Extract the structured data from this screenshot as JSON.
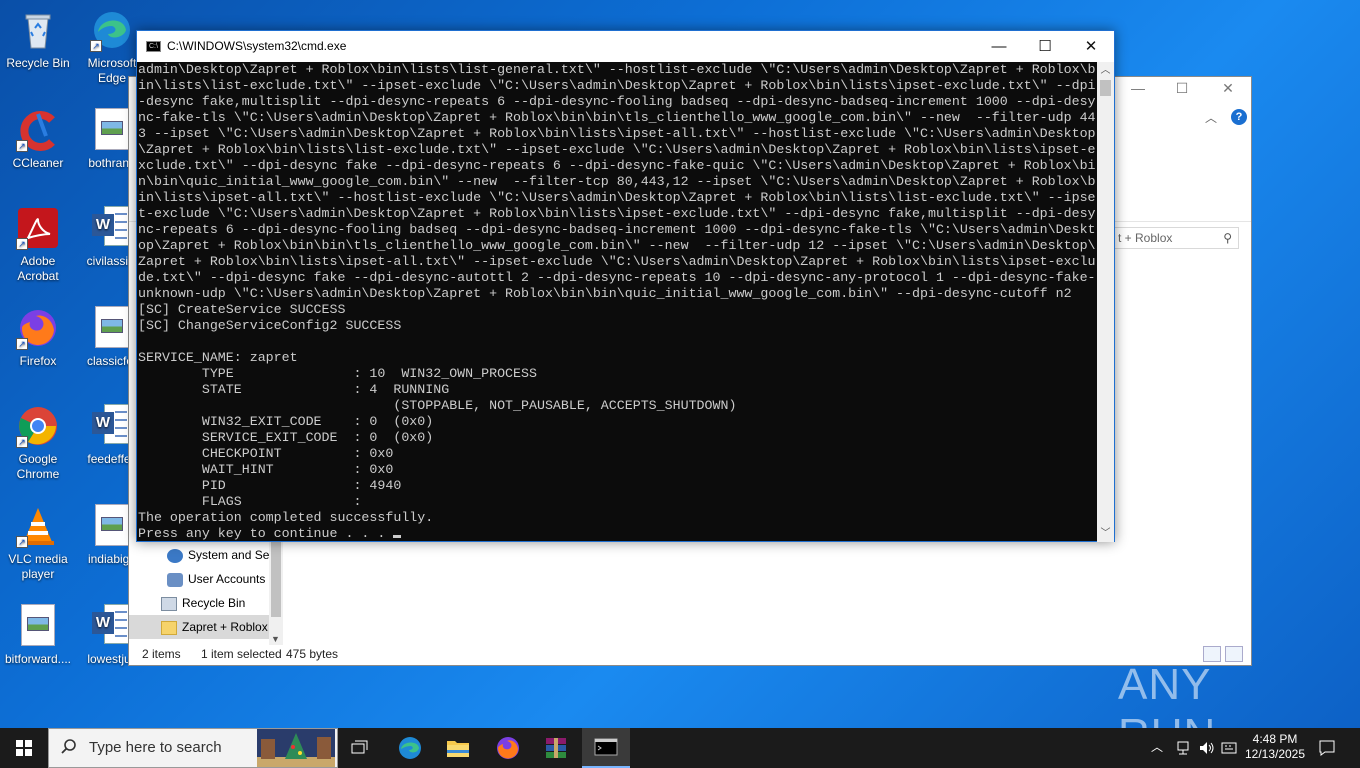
{
  "desktop": {
    "icons": [
      {
        "id": "recycle",
        "label": "Recycle Bin"
      },
      {
        "id": "edge",
        "label": "Microsoft Edge"
      },
      {
        "id": "ccleaner",
        "label": "CCleaner"
      },
      {
        "id": "bothrand",
        "label": "bothrand"
      },
      {
        "id": "acrobat",
        "label": "Adobe Acrobat"
      },
      {
        "id": "civilassist",
        "label": "civilassist"
      },
      {
        "id": "firefox",
        "label": "Firefox"
      },
      {
        "id": "classicfor",
        "label": "classicfor"
      },
      {
        "id": "chrome",
        "label": "Google Chrome"
      },
      {
        "id": "feedeffect",
        "label": "feedeffec"
      },
      {
        "id": "vlc",
        "label": "VLC media player"
      },
      {
        "id": "indiabig",
        "label": "indiabig_"
      },
      {
        "id": "bitforward",
        "label": "bitforward...."
      },
      {
        "id": "lowestjust",
        "label": "lowestjus"
      }
    ]
  },
  "explorer": {
    "search_placeholder": "t + Roblox",
    "nav_items": [
      {
        "label": "System and Se"
      },
      {
        "label": "User Accounts"
      },
      {
        "label": "Recycle Bin"
      },
      {
        "label": "Zapret + Roblox"
      }
    ],
    "status": {
      "items": "2 items",
      "selected": "1 item selected",
      "size": "475 bytes"
    }
  },
  "cmd": {
    "title": "C:\\WINDOWS\\system32\\cmd.exe",
    "lines": [
      "admin\\Desktop\\Zapret + Roblox\\bin\\lists\\list-general.txt\\\" --hostlist-exclude \\\"C:\\Users\\admin\\Desktop\\Zapret + Roblox\\b",
      "in\\lists\\list-exclude.txt\\\" --ipset-exclude \\\"C:\\Users\\admin\\Desktop\\Zapret + Roblox\\bin\\lists\\ipset-exclude.txt\\\" --dpi",
      "-desync fake,multisplit --dpi-desync-repeats 6 --dpi-desync-fooling badseq --dpi-desync-badseq-increment 1000 --dpi-desy",
      "nc-fake-tls \\\"C:\\Users\\admin\\Desktop\\Zapret + Roblox\\bin\\bin\\tls_clienthello_www_google_com.bin\\\" --new  --filter-udp 44",
      "3 --ipset \\\"C:\\Users\\admin\\Desktop\\Zapret + Roblox\\bin\\lists\\ipset-all.txt\\\" --hostlist-exclude \\\"C:\\Users\\admin\\Desktop",
      "\\Zapret + Roblox\\bin\\lists\\list-exclude.txt\\\" --ipset-exclude \\\"C:\\Users\\admin\\Desktop\\Zapret + Roblox\\bin\\lists\\ipset-e",
      "xclude.txt\\\" --dpi-desync fake --dpi-desync-repeats 6 --dpi-desync-fake-quic \\\"C:\\Users\\admin\\Desktop\\Zapret + Roblox\\bi",
      "n\\bin\\quic_initial_www_google_com.bin\\\" --new  --filter-tcp 80,443,12 --ipset \\\"C:\\Users\\admin\\Desktop\\Zapret + Roblox\\b",
      "in\\lists\\ipset-all.txt\\\" --hostlist-exclude \\\"C:\\Users\\admin\\Desktop\\Zapret + Roblox\\bin\\lists\\list-exclude.txt\\\" --ipse",
      "t-exclude \\\"C:\\Users\\admin\\Desktop\\Zapret + Roblox\\bin\\lists\\ipset-exclude.txt\\\" --dpi-desync fake,multisplit --dpi-desy",
      "nc-repeats 6 --dpi-desync-fooling badseq --dpi-desync-badseq-increment 1000 --dpi-desync-fake-tls \\\"C:\\Users\\admin\\Deskt",
      "op\\Zapret + Roblox\\bin\\bin\\tls_clienthello_www_google_com.bin\\\" --new  --filter-udp 12 --ipset \\\"C:\\Users\\admin\\Desktop\\",
      "Zapret + Roblox\\bin\\lists\\ipset-all.txt\\\" --ipset-exclude \\\"C:\\Users\\admin\\Desktop\\Zapret + Roblox\\bin\\lists\\ipset-exclu",
      "de.txt\\\" --dpi-desync fake --dpi-desync-autottl 2 --dpi-desync-repeats 10 --dpi-desync-any-protocol 1 --dpi-desync-fake-",
      "unknown-udp \\\"C:\\Users\\admin\\Desktop\\Zapret + Roblox\\bin\\bin\\quic_initial_www_google_com.bin\\\" --dpi-desync-cutoff n2",
      "[SC] CreateService SUCCESS",
      "[SC] ChangeServiceConfig2 SUCCESS",
      "",
      "SERVICE_NAME: zapret",
      "        TYPE               : 10  WIN32_OWN_PROCESS",
      "        STATE              : 4  RUNNING",
      "                                (STOPPABLE, NOT_PAUSABLE, ACCEPTS_SHUTDOWN)",
      "        WIN32_EXIT_CODE    : 0  (0x0)",
      "        SERVICE_EXIT_CODE  : 0  (0x0)",
      "        CHECKPOINT         : 0x0",
      "        WAIT_HINT          : 0x0",
      "        PID                : 4940",
      "        FLAGS              :",
      "The operation completed successfully.",
      "Press any key to continue . . . "
    ]
  },
  "taskbar": {
    "search_placeholder": "Type here to search",
    "time": "4:48 PM",
    "date": "12/13/2025",
    "apps": [
      "task-view",
      "edge",
      "file-explorer",
      "firefox",
      "winrar",
      "cmd"
    ]
  },
  "watermark": "ANY RUN",
  "colors": {
    "accent": "#1f6fd0",
    "console_bg": "#0c0c0c",
    "console_fg": "#cccccc",
    "taskbar_bg": "#1b1b1b"
  }
}
